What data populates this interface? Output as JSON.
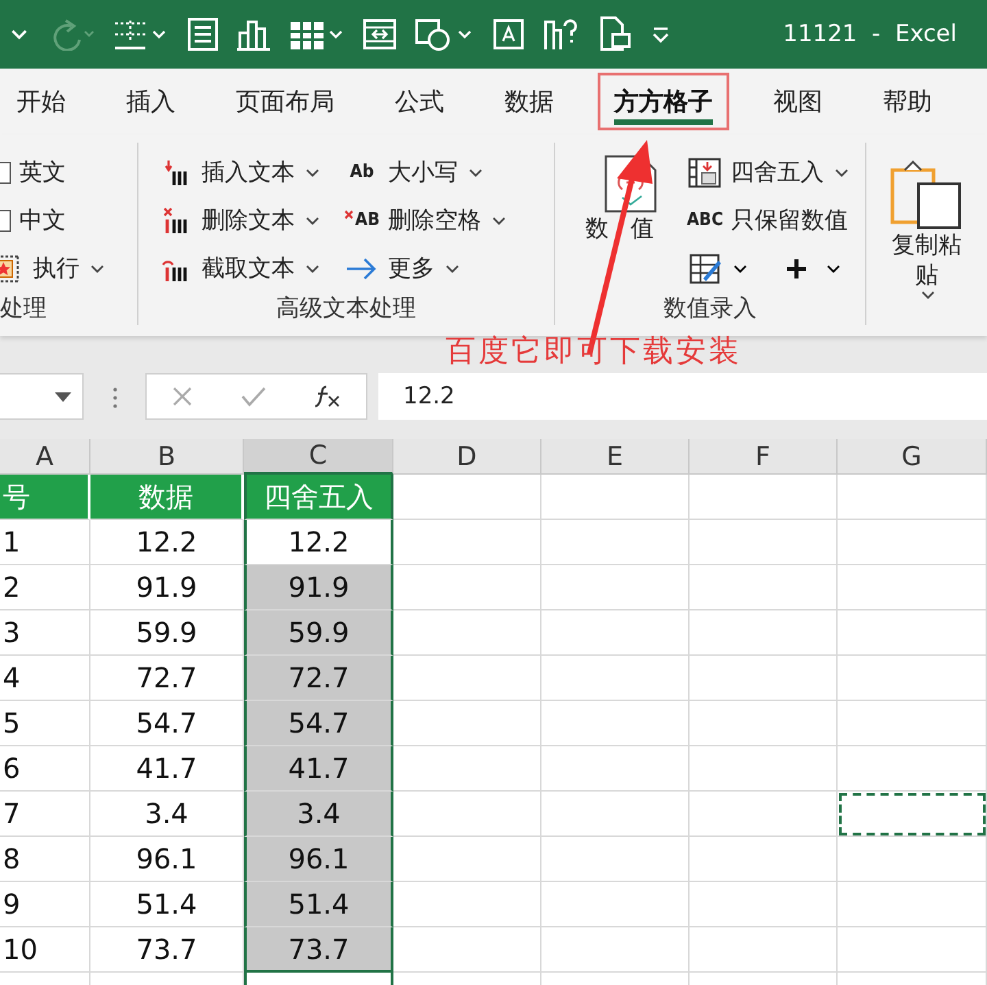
{
  "title_bar": {
    "title": "11121  -  Excel"
  },
  "tabs": [
    {
      "label": "开始",
      "selected": false,
      "highlight": false
    },
    {
      "label": "插入",
      "selected": false,
      "highlight": false
    },
    {
      "label": "页面布局",
      "selected": false,
      "highlight": false
    },
    {
      "label": "公式",
      "selected": false,
      "highlight": false
    },
    {
      "label": "数据",
      "selected": false,
      "highlight": false
    },
    {
      "label": "方方格子",
      "selected": true,
      "highlight": true
    },
    {
      "label": "视图",
      "selected": false,
      "highlight": false
    },
    {
      "label": "帮助",
      "selected": false,
      "highlight": false
    }
  ],
  "ribbon": {
    "groups": [
      {
        "label": "处理",
        "columns": [
          [
            {
              "kind": "checkbox",
              "label": "英文",
              "checked": false
            },
            {
              "kind": "checkbox",
              "label": "中文",
              "checked": false
            },
            {
              "kind": "menu",
              "label": "执行"
            }
          ]
        ]
      },
      {
        "label": "高级文本处理",
        "columns": [
          [
            {
              "kind": "menu",
              "label": "插入文本"
            },
            {
              "kind": "menu",
              "label": "删除文本"
            },
            {
              "kind": "menu",
              "label": "截取文本"
            }
          ],
          [
            {
              "kind": "menu",
              "label": "大小写",
              "icon_text": "Ab"
            },
            {
              "kind": "menu",
              "label": "删除空格",
              "icon_text": "AB"
            },
            {
              "kind": "menu",
              "label": "更多"
            }
          ]
        ]
      },
      {
        "label": "数值录入",
        "large": {
          "label": "数值"
        },
        "columns": [
          [
            {
              "kind": "menu",
              "label": "四舍五入"
            },
            {
              "kind": "button",
              "label": "只保留数值",
              "icon_text": "ABC"
            },
            {
              "kind": "icons"
            }
          ]
        ]
      },
      {
        "large": {
          "label": "复制粘贴",
          "menu": true
        }
      }
    ]
  },
  "formula_bar": {
    "value": "12.2"
  },
  "grid": {
    "columns": [
      {
        "label": "A",
        "selected": false
      },
      {
        "label": "B",
        "selected": false
      },
      {
        "label": "C",
        "selected": true
      },
      {
        "label": "D",
        "selected": false
      },
      {
        "label": "E",
        "selected": false
      },
      {
        "label": "F",
        "selected": false
      },
      {
        "label": "G",
        "selected": false
      }
    ],
    "header_row": [
      "号",
      "数据",
      "四舍五入"
    ],
    "rows": [
      {
        "cells": [
          "1",
          "12.2",
          "12.2"
        ],
        "selected": false,
        "marquee": false
      },
      {
        "cells": [
          "2",
          "91.9",
          "91.9"
        ],
        "selected": true,
        "marquee": false
      },
      {
        "cells": [
          "3",
          "59.9",
          "59.9"
        ],
        "selected": true,
        "marquee": false
      },
      {
        "cells": [
          "4",
          "72.7",
          "72.7"
        ],
        "selected": true,
        "marquee": false
      },
      {
        "cells": [
          "5",
          "54.7",
          "54.7"
        ],
        "selected": true,
        "marquee": false
      },
      {
        "cells": [
          "6",
          "41.7",
          "41.7"
        ],
        "selected": true,
        "marquee": false
      },
      {
        "cells": [
          "7",
          "3.4",
          "3.4"
        ],
        "selected": true,
        "marquee": true
      },
      {
        "cells": [
          "8",
          "96.1",
          "96.1"
        ],
        "selected": true,
        "marquee": false
      },
      {
        "cells": [
          "9",
          "51.4",
          "51.4"
        ],
        "selected": true,
        "marquee": false
      },
      {
        "cells": [
          "10",
          "73.7",
          "73.7"
        ],
        "selected": true,
        "marquee": false
      }
    ]
  },
  "annotation": {
    "text": "百度它即可下载安装"
  }
}
